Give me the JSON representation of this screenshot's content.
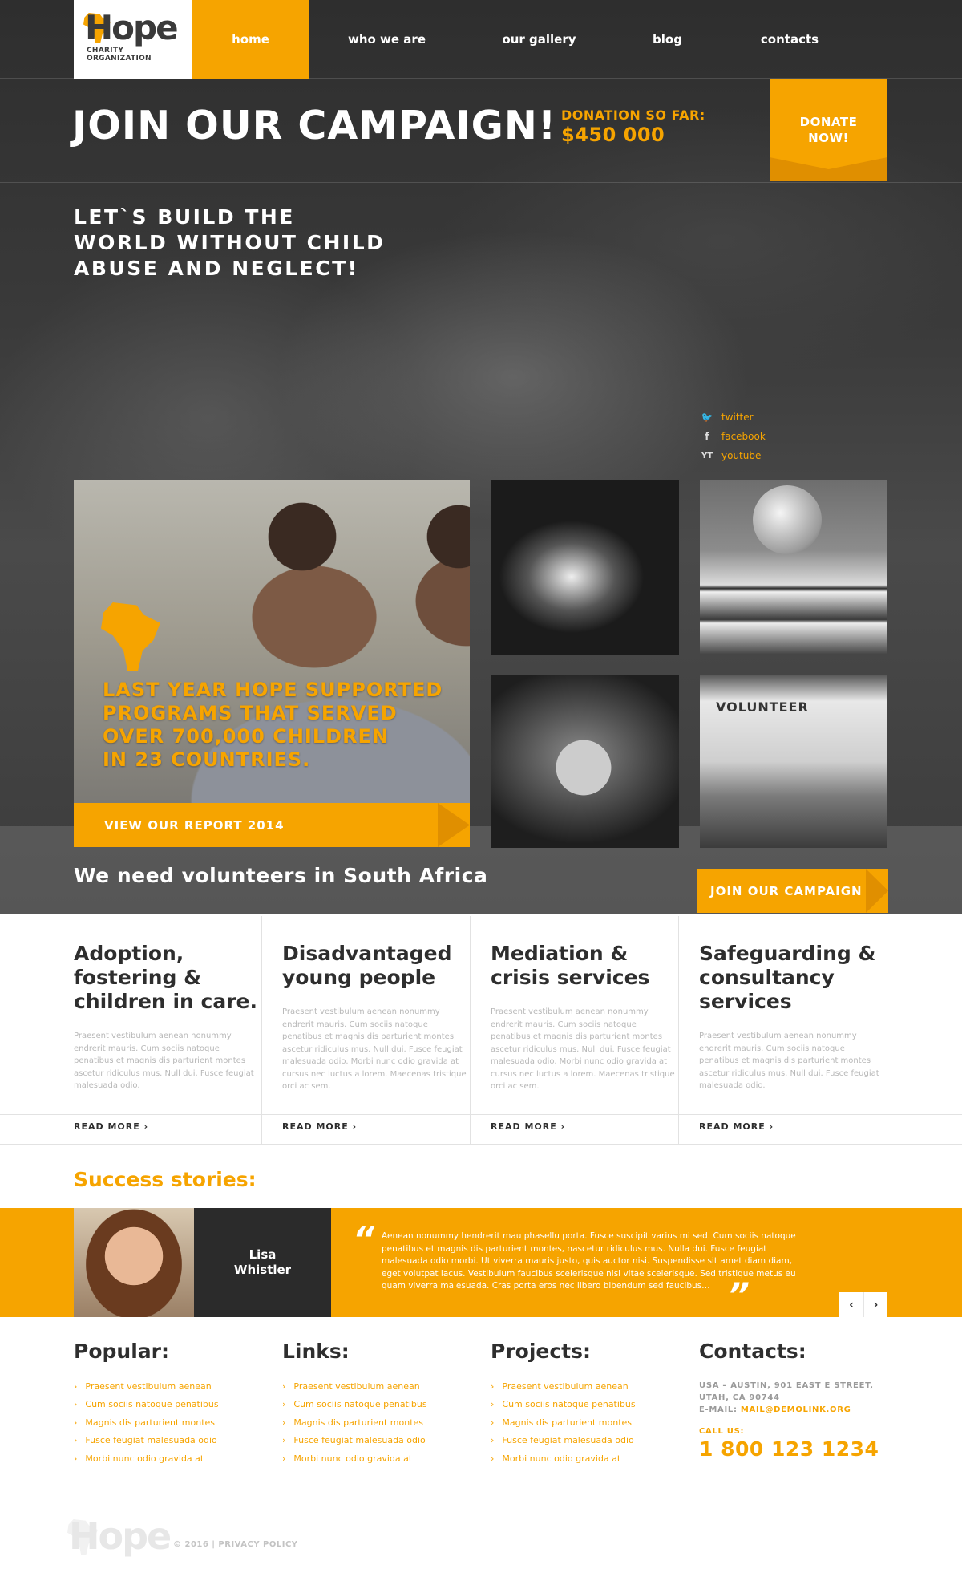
{
  "brand": {
    "logo_word": "Hope",
    "logo_sub": [
      "CHARITY",
      "ORGANIZATION"
    ]
  },
  "nav": {
    "items": [
      "home",
      "who we are",
      "our gallery",
      "blog",
      "contacts"
    ],
    "active": "home"
  },
  "campaign": {
    "title": "JOIN OUR CAMPAIGN!",
    "donation_label": "DONATION SO FAR:",
    "donation_value": "$450 000",
    "donate_button": [
      "DONATE",
      "NOW!"
    ]
  },
  "hero": {
    "tagline": [
      "LET`S BUILD THE",
      "WORLD WITHOUT CHILD",
      "ABUSE AND NEGLECT!"
    ]
  },
  "social": [
    {
      "icon": "twitter-icon",
      "glyph": "🐦",
      "label": "twitter"
    },
    {
      "icon": "facebook-icon",
      "glyph": "f",
      "label": "facebook"
    },
    {
      "icon": "youtube-icon",
      "glyph": "YT",
      "label": "youtube"
    }
  ],
  "feature": {
    "text": [
      "LAST YEAR HOPE SUPPORTED",
      "PROGRAMS THAT SERVED",
      "OVER 700,000 CHILDREN",
      "IN 23 COUNTRIES."
    ],
    "report_button": "VIEW OUR REPORT 2014"
  },
  "gallery": {
    "volunteer_shirt": "VOLUNTEER"
  },
  "volunteers": {
    "heading": "We need volunteers in South Africa",
    "join_button": "JOIN OUR CAMPAIGN"
  },
  "services": [
    {
      "title": [
        "Adoption,",
        "fostering &",
        "children in care."
      ],
      "body": "Praesent vestibulum aenean nonummy endrerit mauris. Cum sociis natoque penatibus et magnis dis parturient montes ascetur ridiculus mus. Null dui. Fusce feugiat malesuada odio.",
      "more": "READ MORE ›"
    },
    {
      "title": [
        "Disadvantaged",
        "young people"
      ],
      "body": "Praesent vestibulum aenean nonummy endrerit mauris. Cum sociis natoque penatibus et magnis dis parturient montes ascetur ridiculus mus. Null dui. Fusce feugiat malesuada odio. Morbi nunc odio gravida at cursus nec luctus a lorem. Maecenas tristique orci ac sem.",
      "more": "READ MORE ›"
    },
    {
      "title": [
        "Mediation &",
        "crisis services"
      ],
      "body": "Praesent vestibulum aenean nonummy endrerit mauris. Cum sociis natoque penatibus et magnis dis parturient montes ascetur ridiculus mus. Null dui. Fusce feugiat malesuada odio. Morbi nunc odio gravida at cursus nec luctus a lorem. Maecenas tristique orci ac sem.",
      "more": "READ MORE ›"
    },
    {
      "title": [
        "Safeguarding &",
        "consultancy",
        "services"
      ],
      "body": "Praesent vestibulum aenean nonummy endrerit mauris. Cum sociis natoque penatibus et magnis dis parturient montes ascetur ridiculus mus. Null dui. Fusce feugiat malesuada odio.",
      "more": "READ MORE ›"
    }
  ],
  "success": {
    "heading": "Success stories:",
    "name": [
      "Lisa",
      "Whistler"
    ],
    "quote": "Aenean nonummy hendrerit mau phasellu porta. Fusce suscipit varius mi sed. Cum sociis natoque penatibus et magnis dis parturient montes, nascetur ridiculus mus. Nulla dui. Fusce feugiat malesuada odio morbi. Ut viverra mauris justo, quis auctor nisi. Suspendisse sit amet diam diam, eget volutpat lacus. Vestibulum faucibus scelerisque nisi vitae scelerisque. Sed tristique metus eu quam viverra malesuada. Cras porta eros nec libero bibendum sed faucibus…",
    "quote_open": "“",
    "quote_close": "”",
    "prev": "‹",
    "next": "›"
  },
  "footer": {
    "columns": [
      {
        "title": "Popular:",
        "links": [
          "Praesent vestibulum aenean",
          "Cum sociis natoque penatibus",
          "Magnis dis parturient montes",
          "Fusce feugiat malesuada odio",
          "Morbi nunc odio gravida at"
        ]
      },
      {
        "title": "Links:",
        "links": [
          "Praesent vestibulum aenean",
          "Cum sociis natoque penatibus",
          "Magnis dis parturient montes",
          "Fusce feugiat malesuada odio",
          "Morbi nunc odio gravida at"
        ]
      },
      {
        "title": "Projects:",
        "links": [
          "Praesent vestibulum aenean",
          "Cum sociis natoque penatibus",
          "Magnis dis parturient montes",
          "Fusce feugiat malesuada odio",
          "Morbi nunc odio gravida at"
        ]
      }
    ],
    "contacts": {
      "title": "Contacts:",
      "address": [
        "USA – AUSTIN, 901 EAST E STREET,",
        "UTAH, CA 90744"
      ],
      "email_label": "E-MAIL:",
      "email": "MAIL@DEMOLINK.ORG",
      "call_label": "CALL US:",
      "phone": "1 800 123 1234"
    },
    "logo_word": "Hope",
    "copyright": "© 2016 | PRIVACY POLICY"
  },
  "colors": {
    "accent": "#f6a400",
    "accent_dark": "#e08f00",
    "dark": "#2b2b2b",
    "text": "#2e2e2e"
  }
}
